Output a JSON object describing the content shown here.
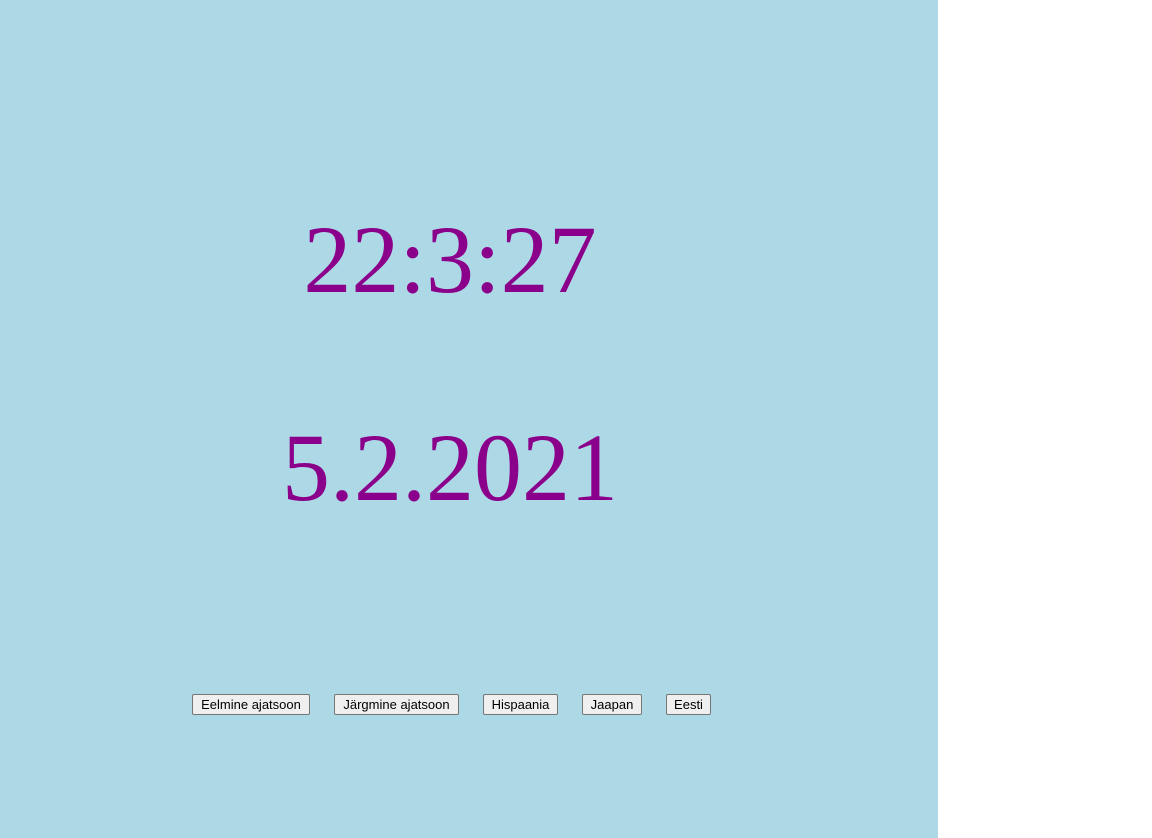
{
  "clock": {
    "time": "22:3:27",
    "date": "5.2.2021"
  },
  "buttons": {
    "previous_timezone": "Eelmine ajatsoon",
    "next_timezone": "Järgmine ajatsoon",
    "spain": "Hispaania",
    "japan": "Jaapan",
    "estonia": "Eesti"
  },
  "colors": {
    "background": "#add8e6",
    "text": "#8b008b"
  }
}
